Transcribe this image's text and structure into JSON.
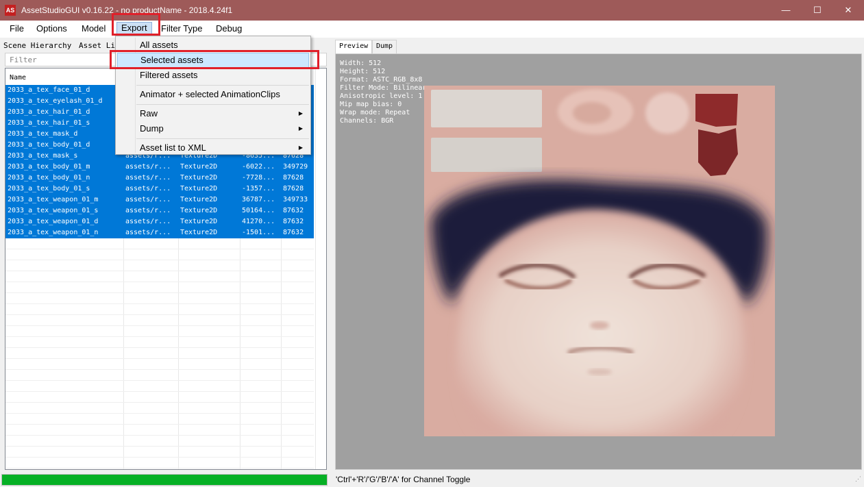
{
  "window": {
    "title": "AssetStudioGUI v0.16.22 - no productName - 2018.4.24f1",
    "icon_text": "AS",
    "minimize_icon": "minimize-icon",
    "maximize_icon": "maximize-icon",
    "close_icon": "close-icon"
  },
  "menubar": {
    "items": [
      "File",
      "Options",
      "Model",
      "Export",
      "Filter Type",
      "Debug"
    ],
    "active": "Export"
  },
  "export_menu": {
    "items": [
      {
        "label": "All assets"
      },
      {
        "label": "Selected assets",
        "highlighted": true
      },
      {
        "label": "Filtered assets"
      },
      {
        "label": "Animator + selected AnimationClips"
      },
      {
        "label": "Raw",
        "submenu": true
      },
      {
        "label": "Dump",
        "submenu": true
      },
      {
        "label": "Asset list to XML",
        "submenu": true
      }
    ]
  },
  "left": {
    "tabs": [
      "Scene Hierarchy",
      "Asset Lis"
    ],
    "filter_placeholder": "Filter",
    "columns": [
      "Name"
    ],
    "rows": [
      {
        "name": "2033_a_tex_face_01_d",
        "container": "",
        "type": "",
        "pathid": "",
        "size": ""
      },
      {
        "name": "2033_a_tex_eyelash_01_d",
        "container": "",
        "type": "",
        "pathid": "",
        "size": ""
      },
      {
        "name": "2033_a_tex_hair_01_d",
        "container": "",
        "type": "",
        "pathid": "",
        "size": ""
      },
      {
        "name": "2033_a_tex_hair_01_s",
        "container": "",
        "type": "",
        "pathid": "",
        "size": ""
      },
      {
        "name": "2033_a_tex_mask_d",
        "container": "",
        "type": "",
        "pathid": "",
        "size": ""
      },
      {
        "name": "2033_a_tex_body_01_d",
        "container": "",
        "type": "",
        "pathid": "",
        "size": ""
      },
      {
        "name": "2033_a_tex_mask_s",
        "container": "assets/r...",
        "type": "Texture2D",
        "pathid": "-8635...",
        "size": "87628"
      },
      {
        "name": "2033_a_tex_body_01_m",
        "container": "assets/r...",
        "type": "Texture2D",
        "pathid": "-6022...",
        "size": "349729"
      },
      {
        "name": "2033_a_tex_body_01_n",
        "container": "assets/r...",
        "type": "Texture2D",
        "pathid": "-7728...",
        "size": "87628"
      },
      {
        "name": "2033_a_tex_body_01_s",
        "container": "assets/r...",
        "type": "Texture2D",
        "pathid": "-1357...",
        "size": "87628"
      },
      {
        "name": "2033_a_tex_weapon_01_m",
        "container": "assets/r...",
        "type": "Texture2D",
        "pathid": "36787...",
        "size": "349733"
      },
      {
        "name": "2033_a_tex_weapon_01_s",
        "container": "assets/r...",
        "type": "Texture2D",
        "pathid": "50164...",
        "size": "87632"
      },
      {
        "name": "2033_a_tex_weapon_01_d",
        "container": "assets/r...",
        "type": "Texture2D",
        "pathid": "41270...",
        "size": "87632"
      },
      {
        "name": "2033_a_tex_weapon_01_n",
        "container": "assets/r...",
        "type": "Texture2D",
        "pathid": "-1501...",
        "size": "87632"
      }
    ],
    "progress": 1.0,
    "progress_color": "#06b025",
    "selection_color": "#0078d7"
  },
  "right": {
    "tabs": [
      "Preview",
      "Dump"
    ],
    "active_tab": "Preview",
    "info": {
      "width": "Width: 512",
      "height": "Height: 512",
      "format": "Format: ASTC_RGB_8x8",
      "filter": "Filter Mode: Bilinear",
      "aniso": "Anisotropic level: 1",
      "mipbias": "Mip map bias: 0",
      "wrap": "Wrap mode: Repeat",
      "channels": "Channels: BGR"
    },
    "status": "'Ctrl'+'R'/'G'/'B'/'A' for Channel Toggle"
  }
}
